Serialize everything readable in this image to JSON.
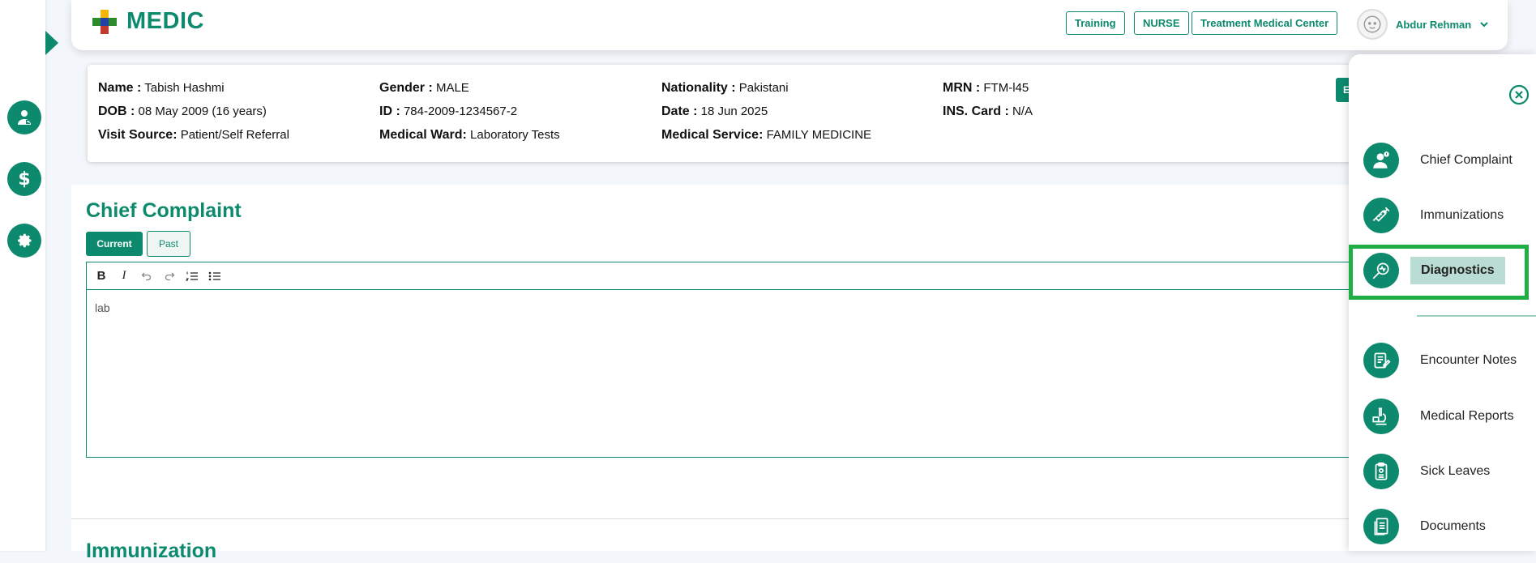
{
  "app": {
    "name": "MEDIC"
  },
  "header": {
    "buttons": {
      "training": "Training",
      "nurse": "NURSE",
      "center": "Treatment Medical Center"
    },
    "user_name": "Abdur Rehman"
  },
  "patient": {
    "name_label": "Name :",
    "name": "Tabish Hashmi",
    "dob_label": "DOB :",
    "dob": "08 May 2009 (16 years)",
    "visit_label": "Visit Source:",
    "visit": "Patient/Self Referral",
    "gender_label": "Gender :",
    "gender": "MALE",
    "id_label": "ID :",
    "id": "784-2009-1234567-2",
    "ward_label": "Medical Ward:",
    "ward": "Laboratory Tests",
    "nationality_label": "Nationality :",
    "nationality": "Pakistani",
    "date_label": "Date :",
    "date": "18 Jun 2025",
    "service_label": "Medical Service:",
    "service": "FAMILY MEDICINE",
    "mrn_label": "MRN :",
    "mrn": "FTM-l45",
    "ins_label": "INS. Card :",
    "ins": "N/A",
    "mini_button": "E"
  },
  "main": {
    "section_title": "Chief Complaint",
    "tabs": {
      "current": "Current",
      "past": "Past"
    },
    "editor": {
      "toolbar": {
        "bold": "B",
        "italic": "I"
      },
      "content": "lab"
    },
    "next_section_title": "Immunization"
  },
  "drawer": {
    "items": [
      {
        "label": "Chief Complaint",
        "icon": "patient-icon"
      },
      {
        "label": "Immunizations",
        "icon": "syringe-icon"
      },
      {
        "label": "Diagnostics",
        "icon": "magnifier-pulse-icon",
        "active": true
      },
      {
        "label": "Encounter Notes",
        "icon": "notes-icon"
      },
      {
        "label": "Medical Reports",
        "icon": "microscope-icon"
      },
      {
        "label": "Sick Leaves",
        "icon": "clipboard-icon"
      },
      {
        "label": "Documents",
        "icon": "documents-icon"
      }
    ]
  },
  "colors": {
    "primary": "#0d8a6e",
    "highlight": "#1fae46",
    "active_bg": "#b9dcd3"
  }
}
